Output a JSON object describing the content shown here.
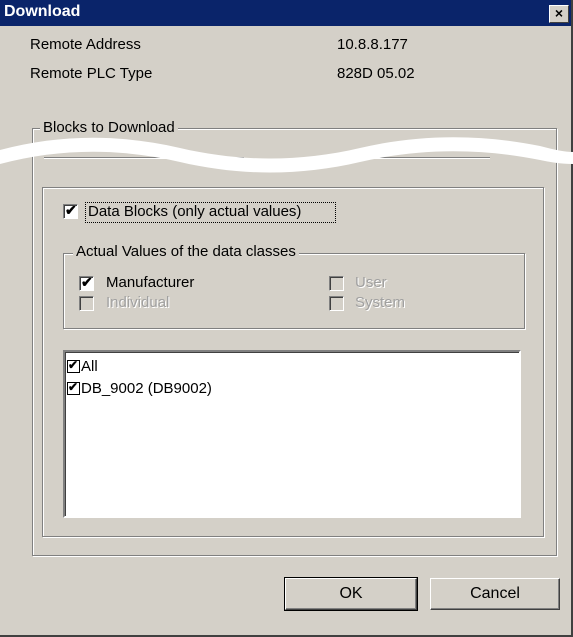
{
  "window": {
    "title": "Download",
    "close_glyph": "×",
    "close_icon": "close-icon"
  },
  "info": {
    "remote_address_label": "Remote Address",
    "remote_address_value": "10.8.8.177",
    "remote_plc_label": "Remote PLC Type",
    "remote_plc_value": "828D 05.02"
  },
  "blocks_group": {
    "legend": "Blocks to Download"
  },
  "data_blocks": {
    "label": "Data Blocks (only actual values)",
    "checked": true
  },
  "classes_group": {
    "legend": "Actual Values of the data classes",
    "manufacturer": {
      "label": "Manufacturer",
      "checked": true,
      "enabled": true
    },
    "user": {
      "label": "User",
      "checked": false,
      "enabled": false
    },
    "individual": {
      "label": "Individual",
      "checked": false,
      "enabled": false
    },
    "system": {
      "label": "System",
      "checked": false,
      "enabled": false
    }
  },
  "list": {
    "items": [
      {
        "label": "All",
        "checked": true
      },
      {
        "label": "DB_9002 (DB9002)",
        "checked": true
      }
    ]
  },
  "buttons": {
    "ok": "OK",
    "cancel": "Cancel"
  },
  "colors": {
    "title_bar": "#0a246a",
    "face": "#d4d0c8"
  }
}
